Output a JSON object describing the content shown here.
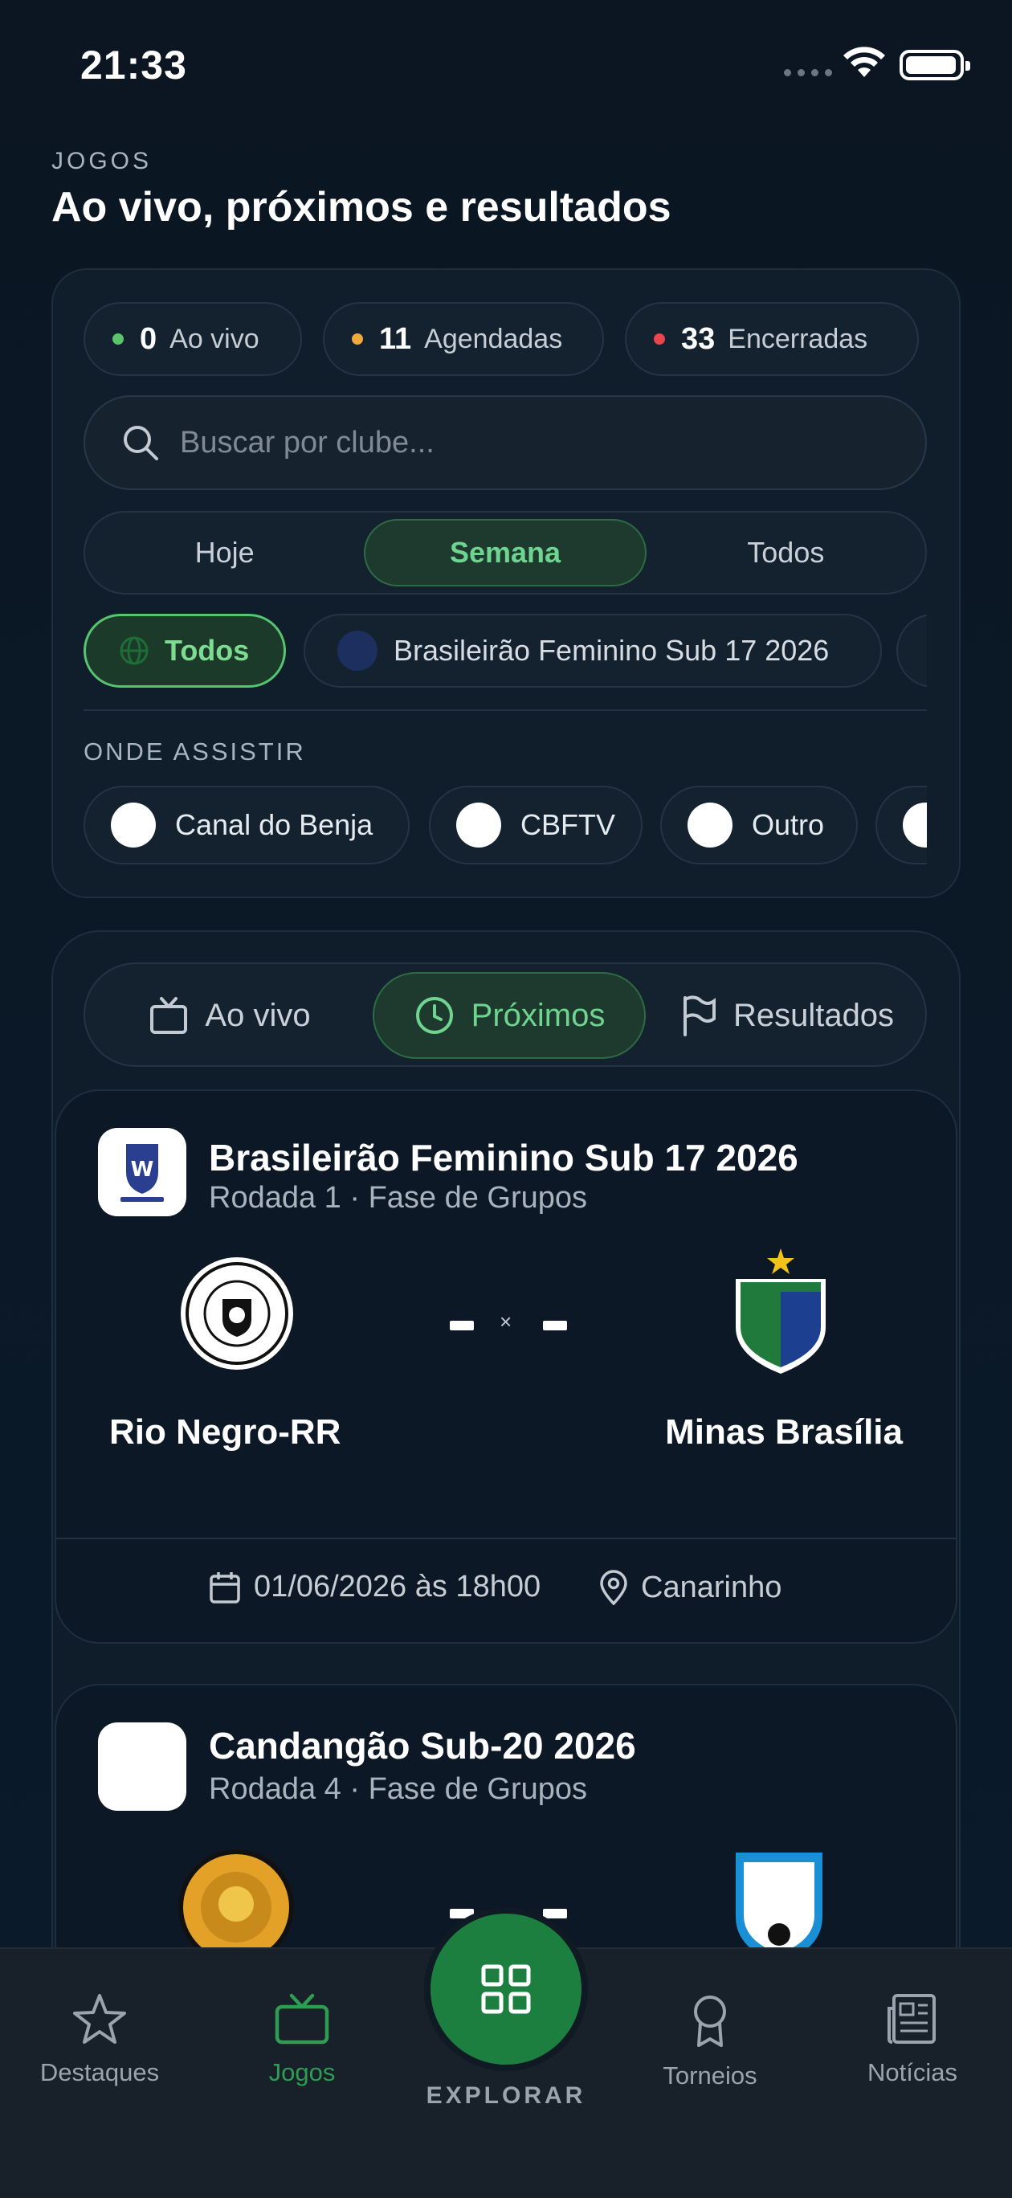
{
  "status_bar": {
    "time": "21:33"
  },
  "header": {
    "section": "JOGOS",
    "title": "Ao vivo, próximos e resultados"
  },
  "stats": [
    {
      "num": "0",
      "label": "Ao vivo",
      "color": "#5cc46b"
    },
    {
      "num": "11",
      "label": "Agendadas",
      "color": "#f0a93c"
    },
    {
      "num": "33",
      "label": "Encerradas",
      "color": "#e8454c"
    }
  ],
  "search": {
    "placeholder": "Buscar por clube..."
  },
  "period": {
    "options": [
      "Hoje",
      "Semana",
      "Todos"
    ],
    "selected": "Semana"
  },
  "competitions": {
    "all": "Todos",
    "items": [
      "Brasileirão Feminino Sub 17 2026"
    ]
  },
  "watch": {
    "label": "ONDE ASSISTIR",
    "channels": [
      "Canal do Benja",
      "CBFTV",
      "Outro"
    ]
  },
  "tabs": {
    "live": "Ao vivo",
    "upcoming": "Próximos",
    "results": "Resultados",
    "selected": "Próximos"
  },
  "matches": [
    {
      "competition": "Brasileirão Feminino Sub 17 2026",
      "round": "Rodada 1 · Fase de Grupos",
      "home": "Rio Negro-RR",
      "away": "Minas Brasília",
      "score": "- × -",
      "datetime": "01/06/2026 às 18h00",
      "venue": "Canarinho"
    },
    {
      "competition": "Candangão Sub-20 2026",
      "round": "Rodada 4 · Fase de Grupos",
      "score": "- × -"
    }
  ],
  "bottom_nav": {
    "items": [
      "Destaques",
      "Jogos",
      "Torneios",
      "Notícias"
    ],
    "center": "EXPLORAR",
    "selected": "Jogos"
  },
  "colors": {
    "accent": "#2e9c52",
    "bg": "#0b1622"
  }
}
